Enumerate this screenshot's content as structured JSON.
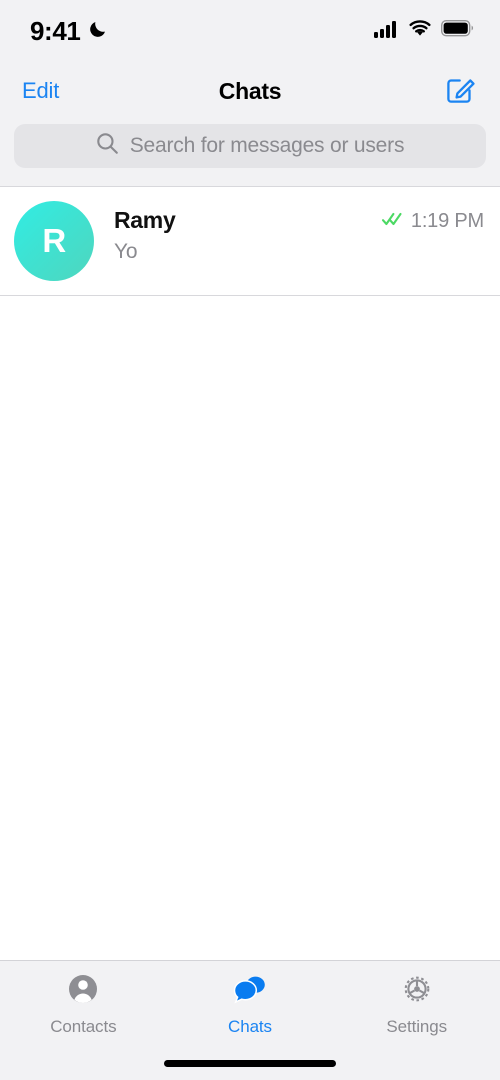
{
  "status_bar": {
    "time": "9:41",
    "dnd_icon": "moon-icon",
    "cellular_icon": "signal-bars-icon",
    "wifi_icon": "wifi-icon",
    "battery_icon": "battery-icon"
  },
  "nav": {
    "edit_label": "Edit",
    "title": "Chats",
    "compose_icon": "compose-icon"
  },
  "search": {
    "placeholder": "Search for messages or users",
    "value": "",
    "icon": "search-icon"
  },
  "chats": [
    {
      "avatar_initial": "R",
      "name": "Ramy",
      "preview": "Yo",
      "time": "1:19 PM",
      "read_status_icon": "double-check-icon",
      "read_status_color": "#4CD964"
    }
  ],
  "tabs": [
    {
      "label": "Contacts",
      "icon": "contacts-person-icon",
      "active": false
    },
    {
      "label": "Chats",
      "icon": "chat-bubbles-icon",
      "active": true
    },
    {
      "label": "Settings",
      "icon": "gear-icon",
      "active": false
    }
  ],
  "colors": {
    "accent": "#1B84F2",
    "header_bg": "#F2F2F4",
    "content_bg": "#FFFFFF",
    "secondary_text": "#8A8A8F",
    "separator": "#D8D8DC",
    "read_check": "#4CD964",
    "avatar_gradient_start": "#31EDE4",
    "avatar_gradient_end": "#4FD6BE"
  },
  "home_indicator": "home-indicator"
}
